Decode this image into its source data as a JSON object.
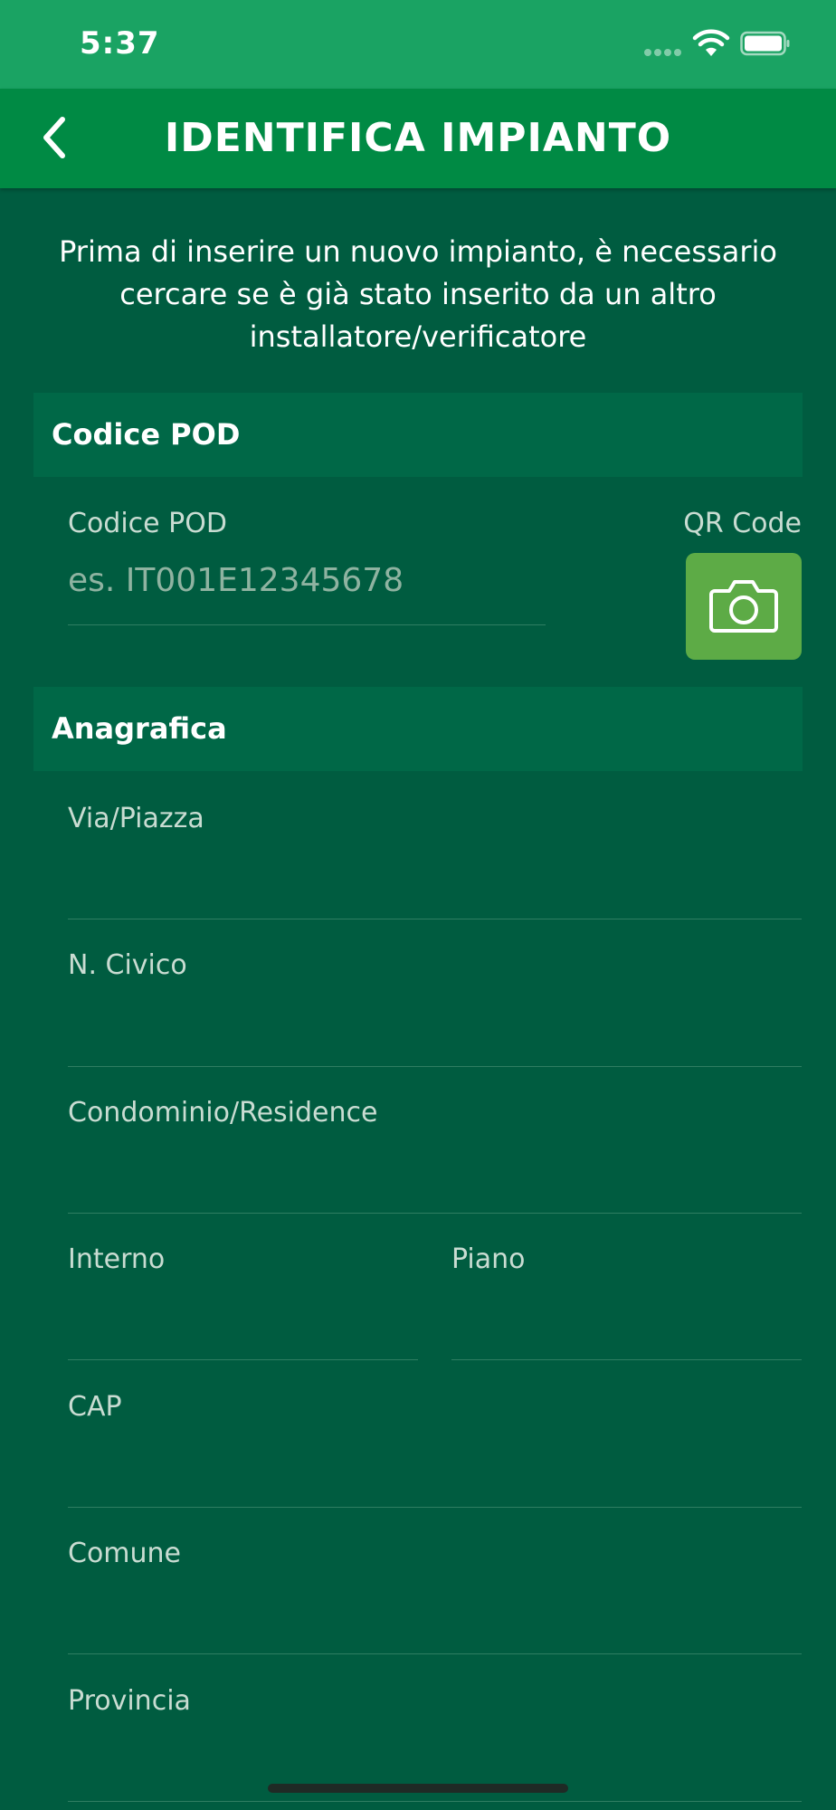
{
  "status_bar": {
    "time": "5:37"
  },
  "header": {
    "title": "IDENTIFICA IMPIANTO"
  },
  "intro": {
    "text": "Prima di inserire un nuovo impianto, è necessario cercare se è già stato inserito da un altro installatore/verificatore"
  },
  "pod_section": {
    "title": "Codice POD",
    "field_label": "Codice POD",
    "field_placeholder": "es. IT001E12345678",
    "field_value": "",
    "qr_label": "QR Code"
  },
  "anagrafica_section": {
    "title": "Anagrafica",
    "fields": [
      {
        "label": "Via/Piazza",
        "value": ""
      },
      {
        "label": "N. Civico",
        "value": ""
      },
      {
        "label": "Condominio/Residence",
        "value": ""
      },
      {
        "label": "Interno",
        "value": ""
      },
      {
        "label": "Piano",
        "value": ""
      },
      {
        "label": "CAP",
        "value": ""
      },
      {
        "label": "Comune",
        "value": ""
      },
      {
        "label": "Provincia",
        "value": ""
      }
    ]
  },
  "icons": {
    "back": "chevron-left-icon",
    "camera": "camera-icon",
    "wifi": "wifi-icon",
    "battery": "battery-icon"
  },
  "colors": {
    "status_bar": "#1aa363",
    "nav_bar": "#008a44",
    "background": "#005c40",
    "section_header": "#006847",
    "qr_button": "#5dab46"
  }
}
